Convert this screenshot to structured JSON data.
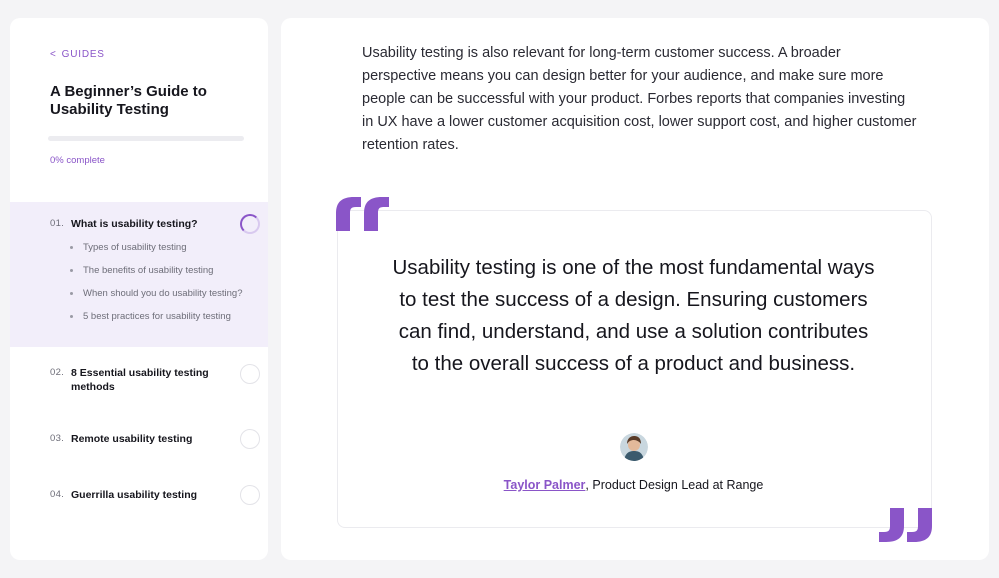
{
  "sidebar": {
    "back_link": "GUIDES",
    "title": "A Beginner’s Guide to Usability Testing",
    "progress_percent": 0,
    "progress_label": "0% complete",
    "sections": [
      {
        "number": "01.",
        "label": "What is usability testing?",
        "active": true,
        "subitems": [
          "Types of usability testing",
          "The benefits of usability testing",
          "When should you do usability testing?",
          "5 best practices for usability testing"
        ]
      },
      {
        "number": "02.",
        "label": "8 Essential usability testing methods",
        "active": false
      },
      {
        "number": "03.",
        "label": "Remote usability testing",
        "active": false
      },
      {
        "number": "04.",
        "label": "Guerrilla usability testing",
        "active": false
      }
    ]
  },
  "main": {
    "paragraph": "Usability testing is also relevant for long-term customer success. A broader perspective means you can design better for your audience, and make sure more people can be successful with your product. Forbes reports that companies investing in UX have a lower customer acquisition cost, lower support cost, and higher customer retention rates.",
    "quote": {
      "text": "Usability testing is one of the most fundamental ways to test the success of a design. Ensuring customers can find, understand, and use a solution contributes to the overall success of a product and business.",
      "author": "Taylor Palmer",
      "author_suffix": ",",
      "role": " Product Design Lead at Range"
    }
  },
  "colors": {
    "accent": "#8a55c8",
    "active_bg": "#f2eefa"
  },
  "icons": [
    "chevron-left-icon",
    "progress-ring-icon",
    "quote-open-icon",
    "quote-close-icon"
  ]
}
